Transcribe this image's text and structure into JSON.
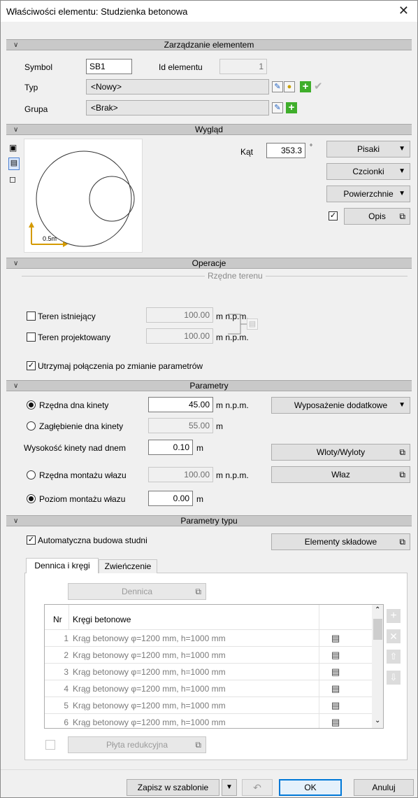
{
  "window": {
    "title": "Właściwości elementu: Studzienka betonowa",
    "close": "✕"
  },
  "sections": {
    "management": "Zarządzanie elementem",
    "appearance": "Wygląd",
    "operations": "Operacje",
    "parameters": "Parametry",
    "type_parameters": "Parametry typu"
  },
  "management": {
    "symbol_label": "Symbol",
    "symbol_value": "SB1",
    "id_label": "Id elementu",
    "id_value": "1",
    "type_label": "Typ",
    "type_value": "<Nowy>",
    "group_label": "Grupa",
    "group_value": "<Brak>"
  },
  "appearance": {
    "angle_label": "Kąt",
    "angle_value": "353.3",
    "angle_unit": "°",
    "pens": "Pisaki",
    "fonts": "Czcionki",
    "surfaces": "Powierzchnie",
    "description": "Opis",
    "description_checked": true,
    "scale_label": "0.5m"
  },
  "operations": {
    "group_title": "Rzędne terenu",
    "existing_label": "Teren istniejący",
    "existing_value": "100.00",
    "existing_unit": "m n.p.m.",
    "designed_label": "Teren projektowany",
    "designed_value": "100.00",
    "designed_unit": "m n.p.m.",
    "keep_connections": "Utrzymaj połączenia po zmianie parametrów"
  },
  "parameters": {
    "bottom_ord_label": "Rzędna dna kinety",
    "bottom_ord_value": "45.00",
    "bottom_ord_unit": "m n.p.m.",
    "depth_label": "Zagłębienie dna kinety",
    "depth_value": "55.00",
    "depth_unit": "m",
    "height_label": "Wysokość kinety nad dnem",
    "height_value": "0.10",
    "height_unit": "m",
    "hatch_ord_label": "Rzędna montażu włazu",
    "hatch_ord_value": "100.00",
    "hatch_ord_unit": "m n.p.m.",
    "hatch_level_label": "Poziom montażu włazu",
    "hatch_level_value": "0.00",
    "hatch_level_unit": "m",
    "extra_equipment": "Wyposażenie dodatkowe",
    "inlets": "Wloty/Wyloty",
    "hatch": "Właz"
  },
  "type_params": {
    "auto_build": "Automatyczna budowa studni",
    "components": "Elementy składowe",
    "tab_bottom": "Dennica i kręgi",
    "tab_top": "Zwieńczenie",
    "bottom_btn": "Dennica",
    "col_nr": "Nr",
    "col_rings": "Kręgi betonowe",
    "rows": [
      {
        "nr": "1",
        "name": "Krąg betonowy φ=1200 mm, h=1000 mm"
      },
      {
        "nr": "2",
        "name": "Krąg betonowy φ=1200 mm, h=1000 mm"
      },
      {
        "nr": "3",
        "name": "Krąg betonowy φ=1200 mm, h=1000 mm"
      },
      {
        "nr": "4",
        "name": "Krąg betonowy φ=1200 mm, h=1000 mm"
      },
      {
        "nr": "5",
        "name": "Krąg betonowy φ=1200 mm, h=1000 mm"
      },
      {
        "nr": "6",
        "name": "Krąg betonowy φ=1200 mm, h=1000 mm"
      }
    ],
    "reduction_plate": "Płyta redukcyjna"
  },
  "footer": {
    "save_template": "Zapisz w szablonie",
    "ok": "OK",
    "cancel": "Anuluj"
  },
  "colors": {
    "accent": "#0078d7",
    "green": "#3fae2b",
    "section": "#c9c9c9"
  }
}
